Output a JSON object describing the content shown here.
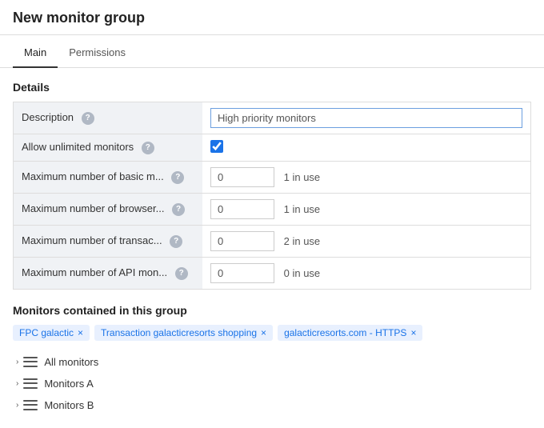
{
  "header": {
    "title": "New monitor group"
  },
  "tabs": [
    {
      "id": "main",
      "label": "Main",
      "active": true
    },
    {
      "id": "permissions",
      "label": "Permissions",
      "active": false
    }
  ],
  "details": {
    "section_title": "Details",
    "rows": [
      {
        "id": "description",
        "label": "Description",
        "type": "text",
        "value": "High priority monitors",
        "has_help": true
      },
      {
        "id": "allow-unlimited",
        "label": "Allow unlimited monitors",
        "type": "checkbox",
        "checked": true,
        "has_help": true
      },
      {
        "id": "max-basic",
        "label": "Maximum number of basic m...",
        "type": "number",
        "value": "0",
        "in_use": "1 in use",
        "has_help": true
      },
      {
        "id": "max-browser",
        "label": "Maximum number of browser...",
        "type": "number",
        "value": "0",
        "in_use": "1 in use",
        "has_help": true
      },
      {
        "id": "max-transaction",
        "label": "Maximum number of transac...",
        "type": "number",
        "value": "0",
        "in_use": "2 in use",
        "has_help": true
      },
      {
        "id": "max-api",
        "label": "Maximum number of API mon...",
        "type": "number",
        "value": "0",
        "in_use": "0 in use",
        "has_help": true
      }
    ]
  },
  "monitors_section": {
    "title": "Monitors contained in this group",
    "tags": [
      {
        "label": "FPC galactic",
        "id": "tag-fpc"
      },
      {
        "label": "Transaction galacticresorts shopping",
        "id": "tag-transaction"
      },
      {
        "label": "galacticresorts.com - HTTPS",
        "id": "tag-https"
      }
    ],
    "tree_items": [
      {
        "label": "All monitors"
      },
      {
        "label": "Monitors A"
      },
      {
        "label": "Monitors B"
      }
    ]
  },
  "icons": {
    "help": "?",
    "chevron": "›",
    "close": "×"
  }
}
